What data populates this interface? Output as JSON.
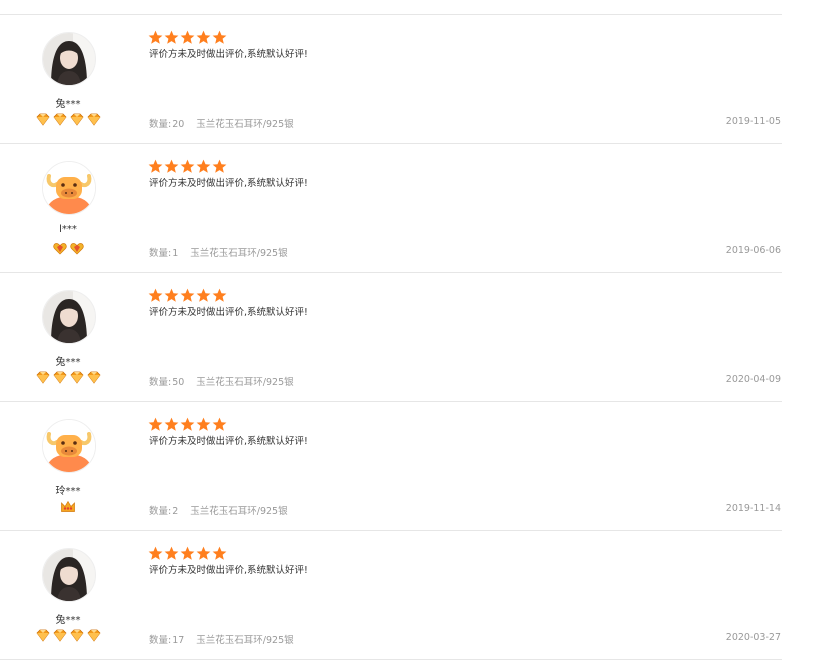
{
  "reviews": [
    {
      "avatar": "photo",
      "username": "兔***",
      "badge_count": 4,
      "badge_type": "diamond",
      "rating": 5,
      "text": "评价方未及时做出评价,系统默认好评!",
      "qty_label": "数量:",
      "qty": "20",
      "product": "玉兰花玉石耳环/925银",
      "date": "2019-11-05"
    },
    {
      "avatar": "cow",
      "username": "l***",
      "badge_count": 2,
      "badge_type": "heart",
      "rating": 5,
      "text": "评价方未及时做出评价,系统默认好评!",
      "qty_label": "数量:",
      "qty": "1",
      "product": "玉兰花玉石耳环/925银",
      "date": "2019-06-06"
    },
    {
      "avatar": "photo",
      "username": "兔***",
      "badge_count": 4,
      "badge_type": "diamond",
      "rating": 5,
      "text": "评价方未及时做出评价,系统默认好评!",
      "qty_label": "数量:",
      "qty": "50",
      "product": "玉兰花玉石耳环/925银",
      "date": "2020-04-09"
    },
    {
      "avatar": "cow",
      "username": "玲***",
      "badge_count": 1,
      "badge_type": "crown",
      "rating": 5,
      "text": "评价方未及时做出评价,系统默认好评!",
      "qty_label": "数量:",
      "qty": "2",
      "product": "玉兰花玉石耳环/925银",
      "date": "2019-11-14"
    },
    {
      "avatar": "photo",
      "username": "兔***",
      "badge_count": 4,
      "badge_type": "diamond",
      "rating": 5,
      "text": "评价方未及时做出评价,系统默认好评!",
      "qty_label": "数量:",
      "qty": "17",
      "product": "玉兰花玉石耳环/925银",
      "date": "2020-03-27"
    }
  ],
  "colors": {
    "star": "#ff7f1e",
    "divider": "#e6e6e6",
    "text": "#333333",
    "meta": "#999999",
    "badge_diamond": "#f29a1a",
    "badge_heart": "#f2b32a",
    "badge_crown": "#f5a623",
    "cow_face": "#ff8a4c"
  }
}
